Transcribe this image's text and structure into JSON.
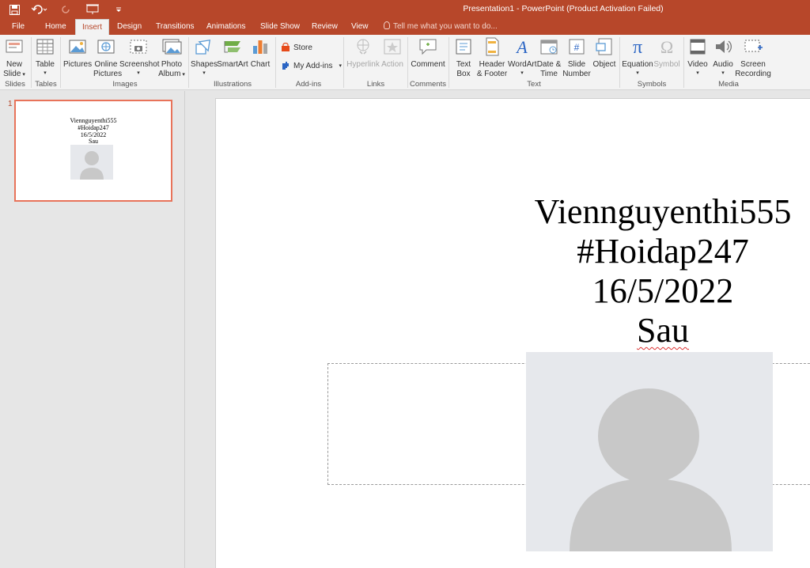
{
  "window": {
    "title": "Presentation1 - PowerPoint (Product Activation Failed)"
  },
  "tabs": [
    {
      "label": "File"
    },
    {
      "label": "Home"
    },
    {
      "label": "Insert"
    },
    {
      "label": "Design"
    },
    {
      "label": "Transitions"
    },
    {
      "label": "Animations"
    },
    {
      "label": "Slide Show"
    },
    {
      "label": "Review"
    },
    {
      "label": "View"
    }
  ],
  "tellme": "Tell me what you want to do...",
  "ribbon": {
    "slides": {
      "new_slide_1": "New",
      "new_slide_2": "Slide",
      "label": "Slides"
    },
    "tables": {
      "table": "Table",
      "label": "Tables"
    },
    "images": {
      "pictures": "Pictures",
      "online_1": "Online",
      "online_2": "Pictures",
      "screenshot": "Screenshot",
      "photo_1": "Photo",
      "photo_2": "Album",
      "label": "Images"
    },
    "illustrations": {
      "shapes": "Shapes",
      "smartart": "SmartArt",
      "chart": "Chart",
      "label": "Illustrations"
    },
    "addins": {
      "store": "Store",
      "my_addins": "My Add-ins",
      "label": "Add-ins"
    },
    "links": {
      "hyperlink": "Hyperlink",
      "action": "Action",
      "label": "Links"
    },
    "comments": {
      "comment": "Comment",
      "label": "Comments"
    },
    "text": {
      "textbox_1": "Text",
      "textbox_2": "Box",
      "header_1": "Header",
      "header_2": "& Footer",
      "wordart": "WordArt",
      "date_1": "Date &",
      "date_2": "Time",
      "slidenum_1": "Slide",
      "slidenum_2": "Number",
      "object": "Object",
      "label": "Text"
    },
    "symbols": {
      "equation": "Equation",
      "symbol": "Symbol",
      "label": "Symbols"
    },
    "media": {
      "video": "Video",
      "audio": "Audio",
      "rec_1": "Screen",
      "rec_2": "Recording",
      "label": "Media"
    }
  },
  "slides_pane": {
    "number": "1"
  },
  "slide": {
    "lines": [
      "Viennguyenthi555",
      "#Hoidap247",
      "16/5/2022",
      "Sau"
    ]
  },
  "colors": {
    "accent": "#b7472a",
    "selection": "#e8735a"
  }
}
